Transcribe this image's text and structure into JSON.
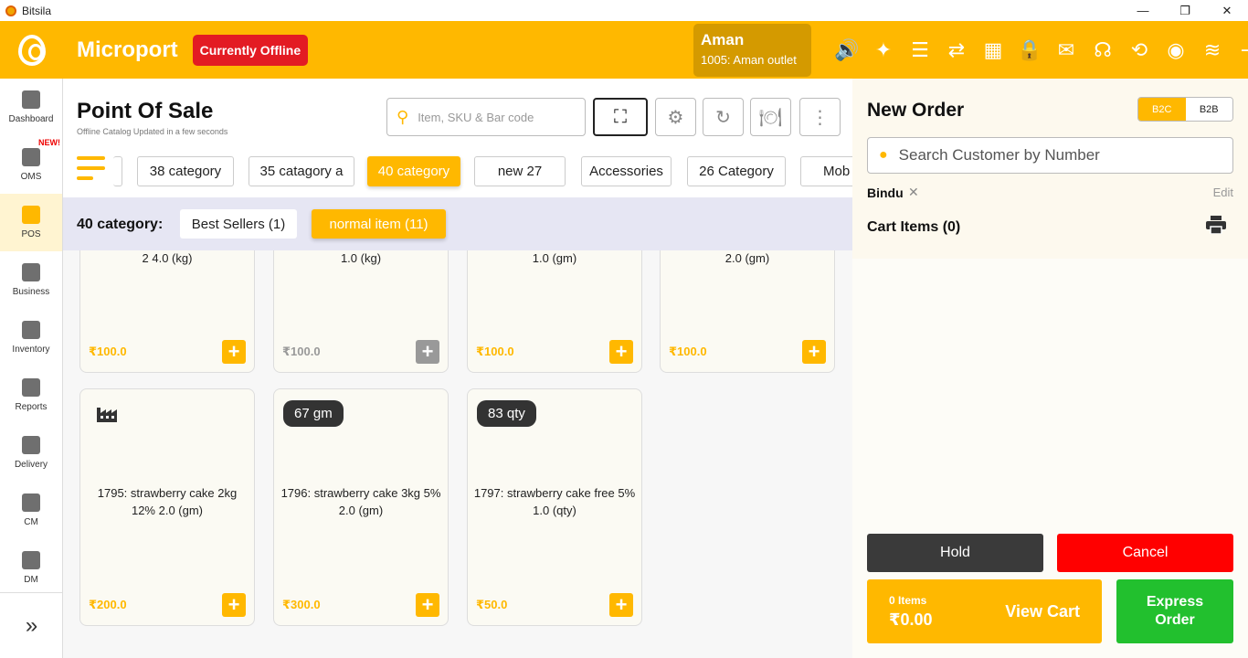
{
  "window": {
    "title": "Bitsila",
    "min": "—",
    "max": "❐",
    "close": "✕"
  },
  "sidebar": {
    "items": [
      {
        "label": "Dashboard",
        "icon": "dashboard-icon"
      },
      {
        "label": "OMS",
        "icon": "oms-icon",
        "badge": "NEW!"
      },
      {
        "label": "POS",
        "icon": "pos-icon"
      },
      {
        "label": "Business",
        "icon": "briefcase-icon"
      },
      {
        "label": "Inventory",
        "icon": "inventory-icon"
      },
      {
        "label": "Reports",
        "icon": "reports-icon"
      },
      {
        "label": "Delivery",
        "icon": "truck-icon"
      },
      {
        "label": "CM",
        "icon": "cm-icon"
      },
      {
        "label": "DM",
        "icon": "dm-icon"
      }
    ],
    "expand": "»"
  },
  "topbar": {
    "brand": "Microport",
    "status": "Currently Offline",
    "user_name": "Aman",
    "user_outlet": "1005: Aman outlet",
    "accent": "#ffb800",
    "status_color": "#e31b23"
  },
  "main": {
    "title": "Point Of Sale",
    "subtitle": "Offline Catalog Updated in a few seconds",
    "search_placeholder": "Item, SKU & Bar code"
  },
  "categories": [
    {
      "label": "38 category"
    },
    {
      "label": "35 catagory a"
    },
    {
      "label": "40 category"
    },
    {
      "label": "new 27"
    },
    {
      "label": "Accessories"
    },
    {
      "label": "26 Category"
    },
    {
      "label": "Mob"
    }
  ],
  "subcategory": {
    "label": "40 category:",
    "chips": [
      {
        "label": "Best Sellers (1)"
      },
      {
        "label": "normal item (11)"
      }
    ]
  },
  "products": [
    {
      "desc": "2 4.0 (kg)",
      "price": "₹100.0"
    },
    {
      "desc": "1.0 (kg)",
      "price": "₹100.0"
    },
    {
      "desc": "1.0 (gm)",
      "price": "₹100.0"
    },
    {
      "desc": "2.0 (gm)",
      "price": "₹100.0"
    },
    {
      "desc": "1795: strawberry cake 2kg 12% 2.0 (gm)",
      "price": "₹200.0"
    },
    {
      "desc": "1796: strawberry cake 3kg 5% 2.0 (gm)",
      "price": "₹300.0",
      "stock": "67 gm"
    },
    {
      "desc": "1797: strawberry cake free 5% 1.0 (qty)",
      "price": "₹50.0",
      "stock": "83 qty"
    }
  ],
  "order": {
    "title": "New Order",
    "mode_b2c": "B2C",
    "mode_b2b": "B2B",
    "customer_placeholder": "Search Customer by Number",
    "customer_name": "Bindu",
    "remove": "✕",
    "edit": "Edit",
    "cart_label": "Cart Items (0)",
    "hold": "Hold",
    "cancel": "Cancel",
    "items_count": "0 Items",
    "total": "₹0.00",
    "view_cart": "View Cart",
    "express": "Express Order"
  }
}
